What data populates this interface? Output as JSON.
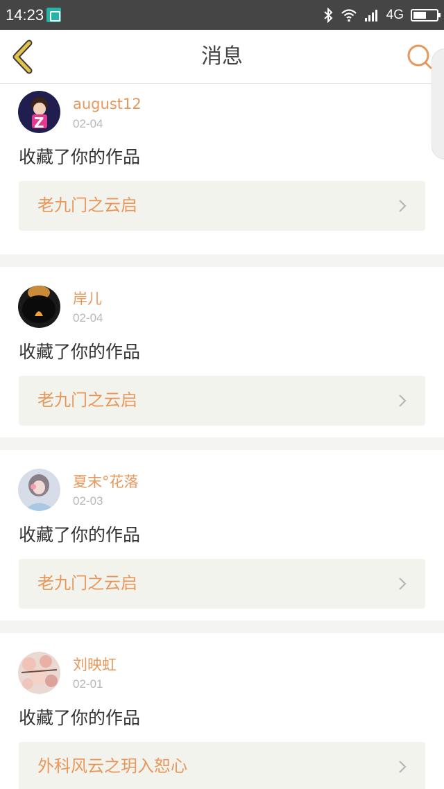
{
  "status_bar": {
    "time": "14:23",
    "network": "4G",
    "battery_level": 0.55,
    "icons": [
      "screenshot-icon",
      "bluetooth-icon",
      "wifi-icon",
      "signal-icon",
      "battery-icon"
    ]
  },
  "nav": {
    "title": "消息",
    "back_icon": "chevron-left-icon",
    "search_icon": "search-icon"
  },
  "colors": {
    "accent": "#e8975b",
    "back_icon": "#e2c24a",
    "status_bar_bg": "#454545",
    "work_link_bg": "#f3f3ed"
  },
  "messages": [
    {
      "username": "august12",
      "date": "02-04",
      "action": "收藏了你的作品",
      "work_title": "老九门之云启"
    },
    {
      "username": "岸儿",
      "date": "02-04",
      "action": "收藏了你的作品",
      "work_title": "老九门之云启"
    },
    {
      "username": "夏末°花落",
      "date": "02-03",
      "action": "收藏了你的作品",
      "work_title": "老九门之云启"
    },
    {
      "username": "刘映虹",
      "date": "02-01",
      "action": "收藏了你的作品",
      "work_title": "外科风云之玥入恕心"
    }
  ]
}
